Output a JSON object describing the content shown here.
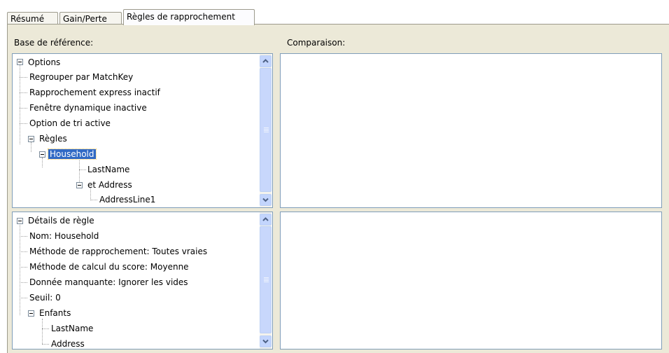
{
  "tabs": [
    {
      "label": "Résumé",
      "active": false
    },
    {
      "label": "Gain/Perte",
      "active": false
    },
    {
      "label": "Règles de rapprochement",
      "active": true
    }
  ],
  "columns": {
    "reference": "Base de référence:",
    "comparison": "Comparaison:"
  },
  "options_tree": {
    "root": "Options",
    "items": [
      "Regrouper par MatchKey",
      "Rapprochement express inactif",
      "Fenêtre dynamique inactive",
      "Option de tri active"
    ],
    "rules_label": "Règles",
    "rule_name": "Household",
    "rule_child": "LastName",
    "rule_group": "et Address",
    "rule_group_child": "AddressLine1"
  },
  "details_tree": {
    "root": "Détails de règle",
    "items": [
      "Nom: Household",
      "Méthode de rapprochement: Toutes vraies",
      "Méthode de calcul du score: Moyenne",
      "Donnée manquante: Ignorer les vides",
      "Seuil: 0"
    ],
    "children_label": "Enfants",
    "children": [
      "LastName",
      "Address"
    ]
  },
  "colors": {
    "selection": "#316ac5",
    "panel_bg": "#ece9d8",
    "border": "#7f9db9",
    "scrollbar": "#c3d5fd"
  }
}
